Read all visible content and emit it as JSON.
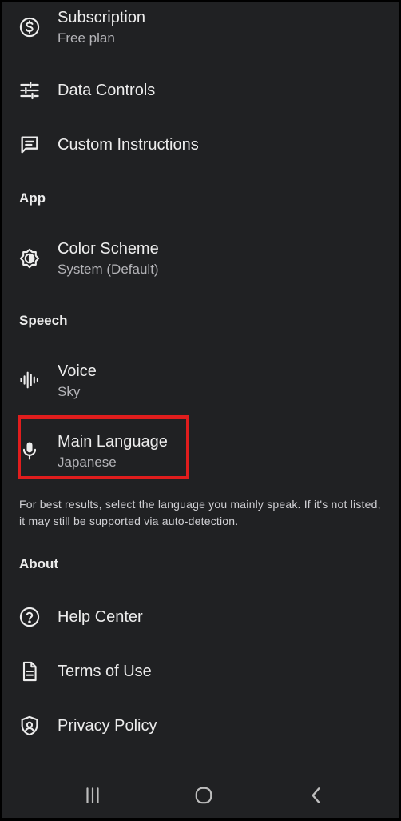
{
  "settings": {
    "subscription": {
      "label": "Subscription",
      "value": "Free plan",
      "icon": "dollar-circle-icon"
    },
    "data_controls": {
      "label": "Data Controls",
      "icon": "sliders-icon"
    },
    "custom_instructions": {
      "label": "Custom Instructions",
      "icon": "message-square-icon"
    }
  },
  "sections": {
    "app": "App",
    "speech": "Speech",
    "about": "About"
  },
  "app": {
    "color_scheme": {
      "label": "Color Scheme",
      "value": "System (Default)",
      "icon": "brightness-icon"
    }
  },
  "speech": {
    "voice": {
      "label": "Voice",
      "value": "Sky",
      "icon": "waveform-icon"
    },
    "main_language": {
      "label": "Main Language",
      "value": "Japanese",
      "icon": "microphone-icon"
    },
    "helper_text": "For best results, select the language you mainly speak. If it's not listed, it may still be supported via auto-detection."
  },
  "about": {
    "help_center": {
      "label": "Help Center",
      "icon": "help-circle-icon"
    },
    "terms_of_use": {
      "label": "Terms of Use",
      "icon": "document-icon"
    },
    "privacy_policy": {
      "label": "Privacy Policy",
      "icon": "shield-icon"
    }
  },
  "navbar": {
    "recents": "recents-icon",
    "home": "home-icon",
    "back": "back-icon"
  },
  "colors": {
    "background": "#202123",
    "text": "#ececec",
    "secondary_text": "#b4b4b8",
    "highlight": "#e01d1d"
  }
}
